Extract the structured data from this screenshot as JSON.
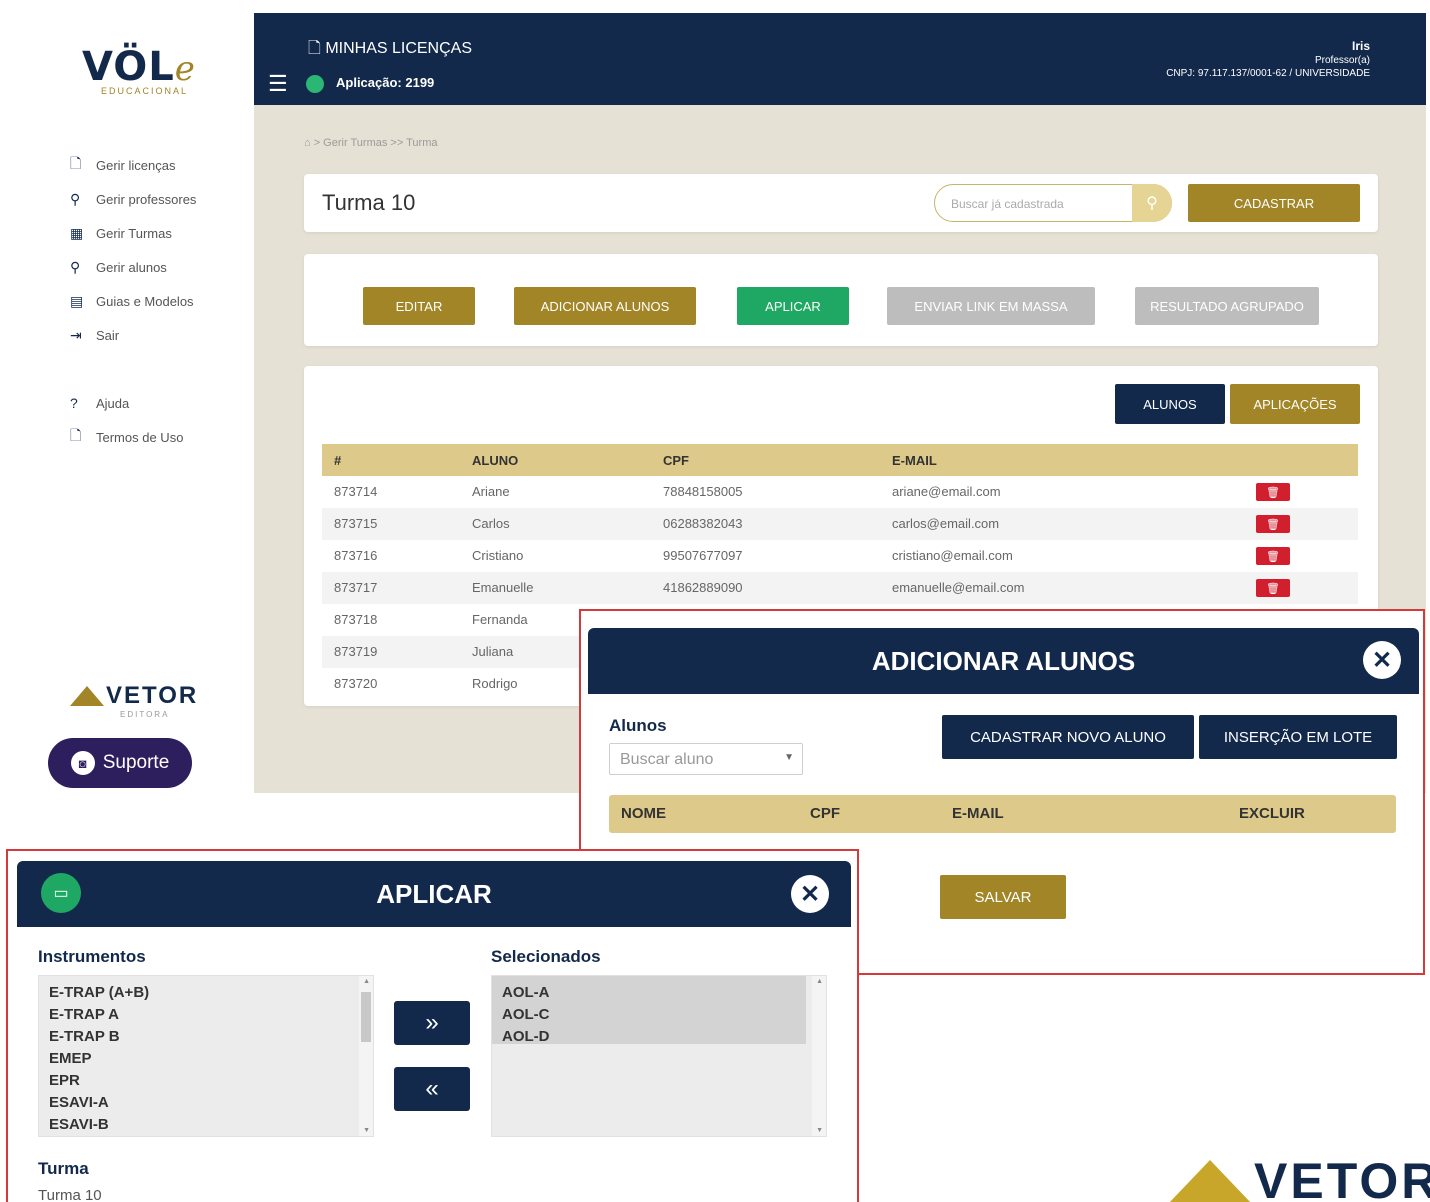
{
  "sidebar": {
    "logo": "VÖL",
    "logo_e": "e",
    "logo_sub": "EDUCACIONAL",
    "items": [
      {
        "label": "Gerir licenças",
        "icon": "document-icon"
      },
      {
        "label": "Gerir professores",
        "icon": "user-icon"
      },
      {
        "label": "Gerir Turmas",
        "icon": "grid-icon"
      },
      {
        "label": "Gerir alunos",
        "icon": "user-icon"
      },
      {
        "label": "Guias e Modelos",
        "icon": "guide-icon"
      },
      {
        "label": "Sair",
        "icon": "exit-icon"
      }
    ],
    "help": {
      "label": "Ajuda",
      "icon": "question-icon"
    },
    "terms": {
      "label": "Termos de Uso",
      "icon": "document-icon"
    },
    "brand": "VETOR",
    "brand_sub": "EDITORA",
    "support": "Suporte"
  },
  "topbar": {
    "title": "MINHAS LICENÇAS",
    "app": "Aplicação: 2199",
    "user": "Iris",
    "role": "Professor(a)",
    "cnpj": "CNPJ: 97.117.137/0001-62 / UNIVERSIDADE"
  },
  "breadcrumb": "⌂  >  Gerir Turmas  >>  Turma",
  "header": {
    "title": "Turma 10",
    "search_placeholder": "Buscar já cadastrada",
    "register": "CADASTRAR"
  },
  "actions": {
    "edit": "EDITAR",
    "add_students": "ADICIONAR ALUNOS",
    "apply": "APLICAR",
    "send_link": "ENVIAR LINK EM MASSA",
    "grouped": "RESULTADO AGRUPADO"
  },
  "tabs": {
    "students": "ALUNOS",
    "applications": "APLICAÇÕES"
  },
  "table": {
    "headers": [
      "#",
      "ALUNO",
      "CPF",
      "E-MAIL"
    ],
    "rows": [
      {
        "id": "873714",
        "name": "Ariane",
        "cpf": "78848158005",
        "email": "ariane@email.com"
      },
      {
        "id": "873715",
        "name": "Carlos",
        "cpf": "06288382043",
        "email": "carlos@email.com"
      },
      {
        "id": "873716",
        "name": "Cristiano",
        "cpf": "99507677097",
        "email": "cristiano@email.com"
      },
      {
        "id": "873717",
        "name": "Emanuelle",
        "cpf": "41862889090",
        "email": "emanuelle@email.com"
      },
      {
        "id": "873718",
        "name": "Fernanda"
      },
      {
        "id": "873719",
        "name": "Juliana"
      },
      {
        "id": "873720",
        "name": "Rodrigo"
      }
    ]
  },
  "modal_add": {
    "title": "ADICIONAR ALUNOS",
    "label": "Alunos",
    "select_placeholder": "Buscar aluno",
    "new_student": "CADASTRAR NOVO ALUNO",
    "batch": "INSERÇÃO EM LOTE",
    "headers": [
      "NOME",
      "CPF",
      "E-MAIL",
      "EXCLUIR"
    ],
    "save": "SALVAR"
  },
  "modal_apply": {
    "title": "APLICAR",
    "instruments_label": "Instrumentos",
    "instruments": [
      "E-TRAP (A+B)",
      "E-TRAP A",
      "E-TRAP B",
      "EMEP",
      "EPR",
      "ESAVI-A",
      "ESAVI-B"
    ],
    "selected_label": "Selecionados",
    "selected": [
      "AOL-A",
      "AOL-C",
      "AOL-D"
    ],
    "add_arrow": "»",
    "remove_arrow": "«",
    "class_label": "Turma",
    "class_value": "Turma 10"
  },
  "brand_bottom": "VETOR",
  "colors": {
    "navy": "#13294b",
    "gold": "#a18526",
    "green": "#1fa863",
    "red": "#d11f2e",
    "frame": "#d43a3a"
  }
}
